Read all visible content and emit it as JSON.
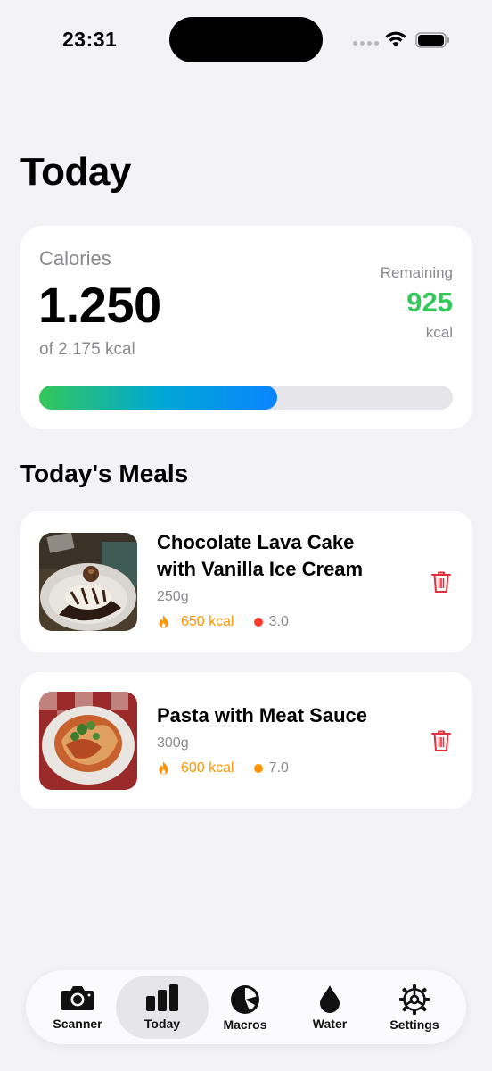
{
  "status_bar": {
    "time": "23:31"
  },
  "page": {
    "title": "Today"
  },
  "calories": {
    "label": "Calories",
    "consumed": "1.250",
    "goal_text": "of 2.175 kcal",
    "remaining_label": "Remaining",
    "remaining_value": "925",
    "remaining_unit": "kcal",
    "progress_fraction": 0.575,
    "colors": {
      "remaining": "#34c759",
      "gradient_start": "#34c759",
      "gradient_end": "#0a84ff"
    }
  },
  "meals_section": {
    "title": "Today's Meals",
    "items": [
      {
        "name": "Chocolate Lava Cake with Vanilla Ice Cream",
        "weight": "250g",
        "kcal": "650 kcal",
        "score": "3.0",
        "score_color": "#ff3b30",
        "image_icon": "chocolate-lava-cake-photo"
      },
      {
        "name": "Pasta with Meat Sauce",
        "weight": "300g",
        "kcal": "600 kcal",
        "score": "7.0",
        "score_color": "#ff9500",
        "image_icon": "pasta-meat-sauce-photo"
      }
    ]
  },
  "tab_bar": {
    "tabs": [
      {
        "label": "Scanner",
        "icon": "camera-icon"
      },
      {
        "label": "Today",
        "icon": "bar-chart-icon",
        "active": true
      },
      {
        "label": "Macros",
        "icon": "pie-chart-icon"
      },
      {
        "label": "Water",
        "icon": "drop-icon"
      },
      {
        "label": "Settings",
        "icon": "gear-icon"
      }
    ]
  }
}
